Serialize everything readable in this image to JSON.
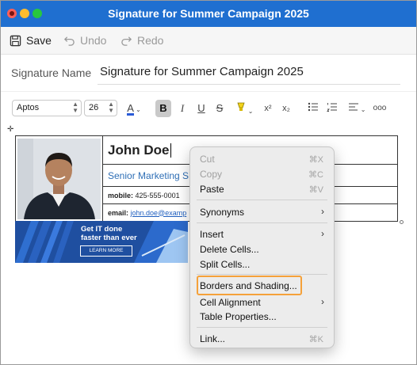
{
  "window": {
    "title": "Signature for Summer Campaign 2025"
  },
  "toolbar": {
    "save": "Save",
    "undo": "Undo",
    "redo": "Redo"
  },
  "signature_name": {
    "label": "Signature Name",
    "value": "Signature for Summer Campaign 2025"
  },
  "format": {
    "font": "Aptos",
    "size": "26",
    "superscript": "x²",
    "subscript": "x₂",
    "more": "ooo"
  },
  "signature": {
    "name": "John Doe",
    "title": "Senior Marketing S",
    "mobile_label": "mobile:",
    "mobile": "425-555-0001",
    "email_label": "email:",
    "email": "john.doe@examp",
    "banner_line1": "Get IT done",
    "banner_line2": "faster than ever",
    "banner_button": "LEARN MORE"
  },
  "context_menu": {
    "cut": "Cut",
    "cut_sc": "⌘X",
    "copy": "Copy",
    "copy_sc": "⌘C",
    "paste": "Paste",
    "paste_sc": "⌘V",
    "synonyms": "Synonyms",
    "insert": "Insert",
    "delete_cells": "Delete Cells...",
    "split_cells": "Split Cells...",
    "borders_shading": "Borders and Shading...",
    "cell_alignment": "Cell Alignment",
    "table_properties": "Table Properties...",
    "link": "Link...",
    "link_sc": "⌘K"
  },
  "colors": {
    "titlebar": "#1f6fd0",
    "highlight": "#f5a13a",
    "banner": "#1f4fa0"
  }
}
